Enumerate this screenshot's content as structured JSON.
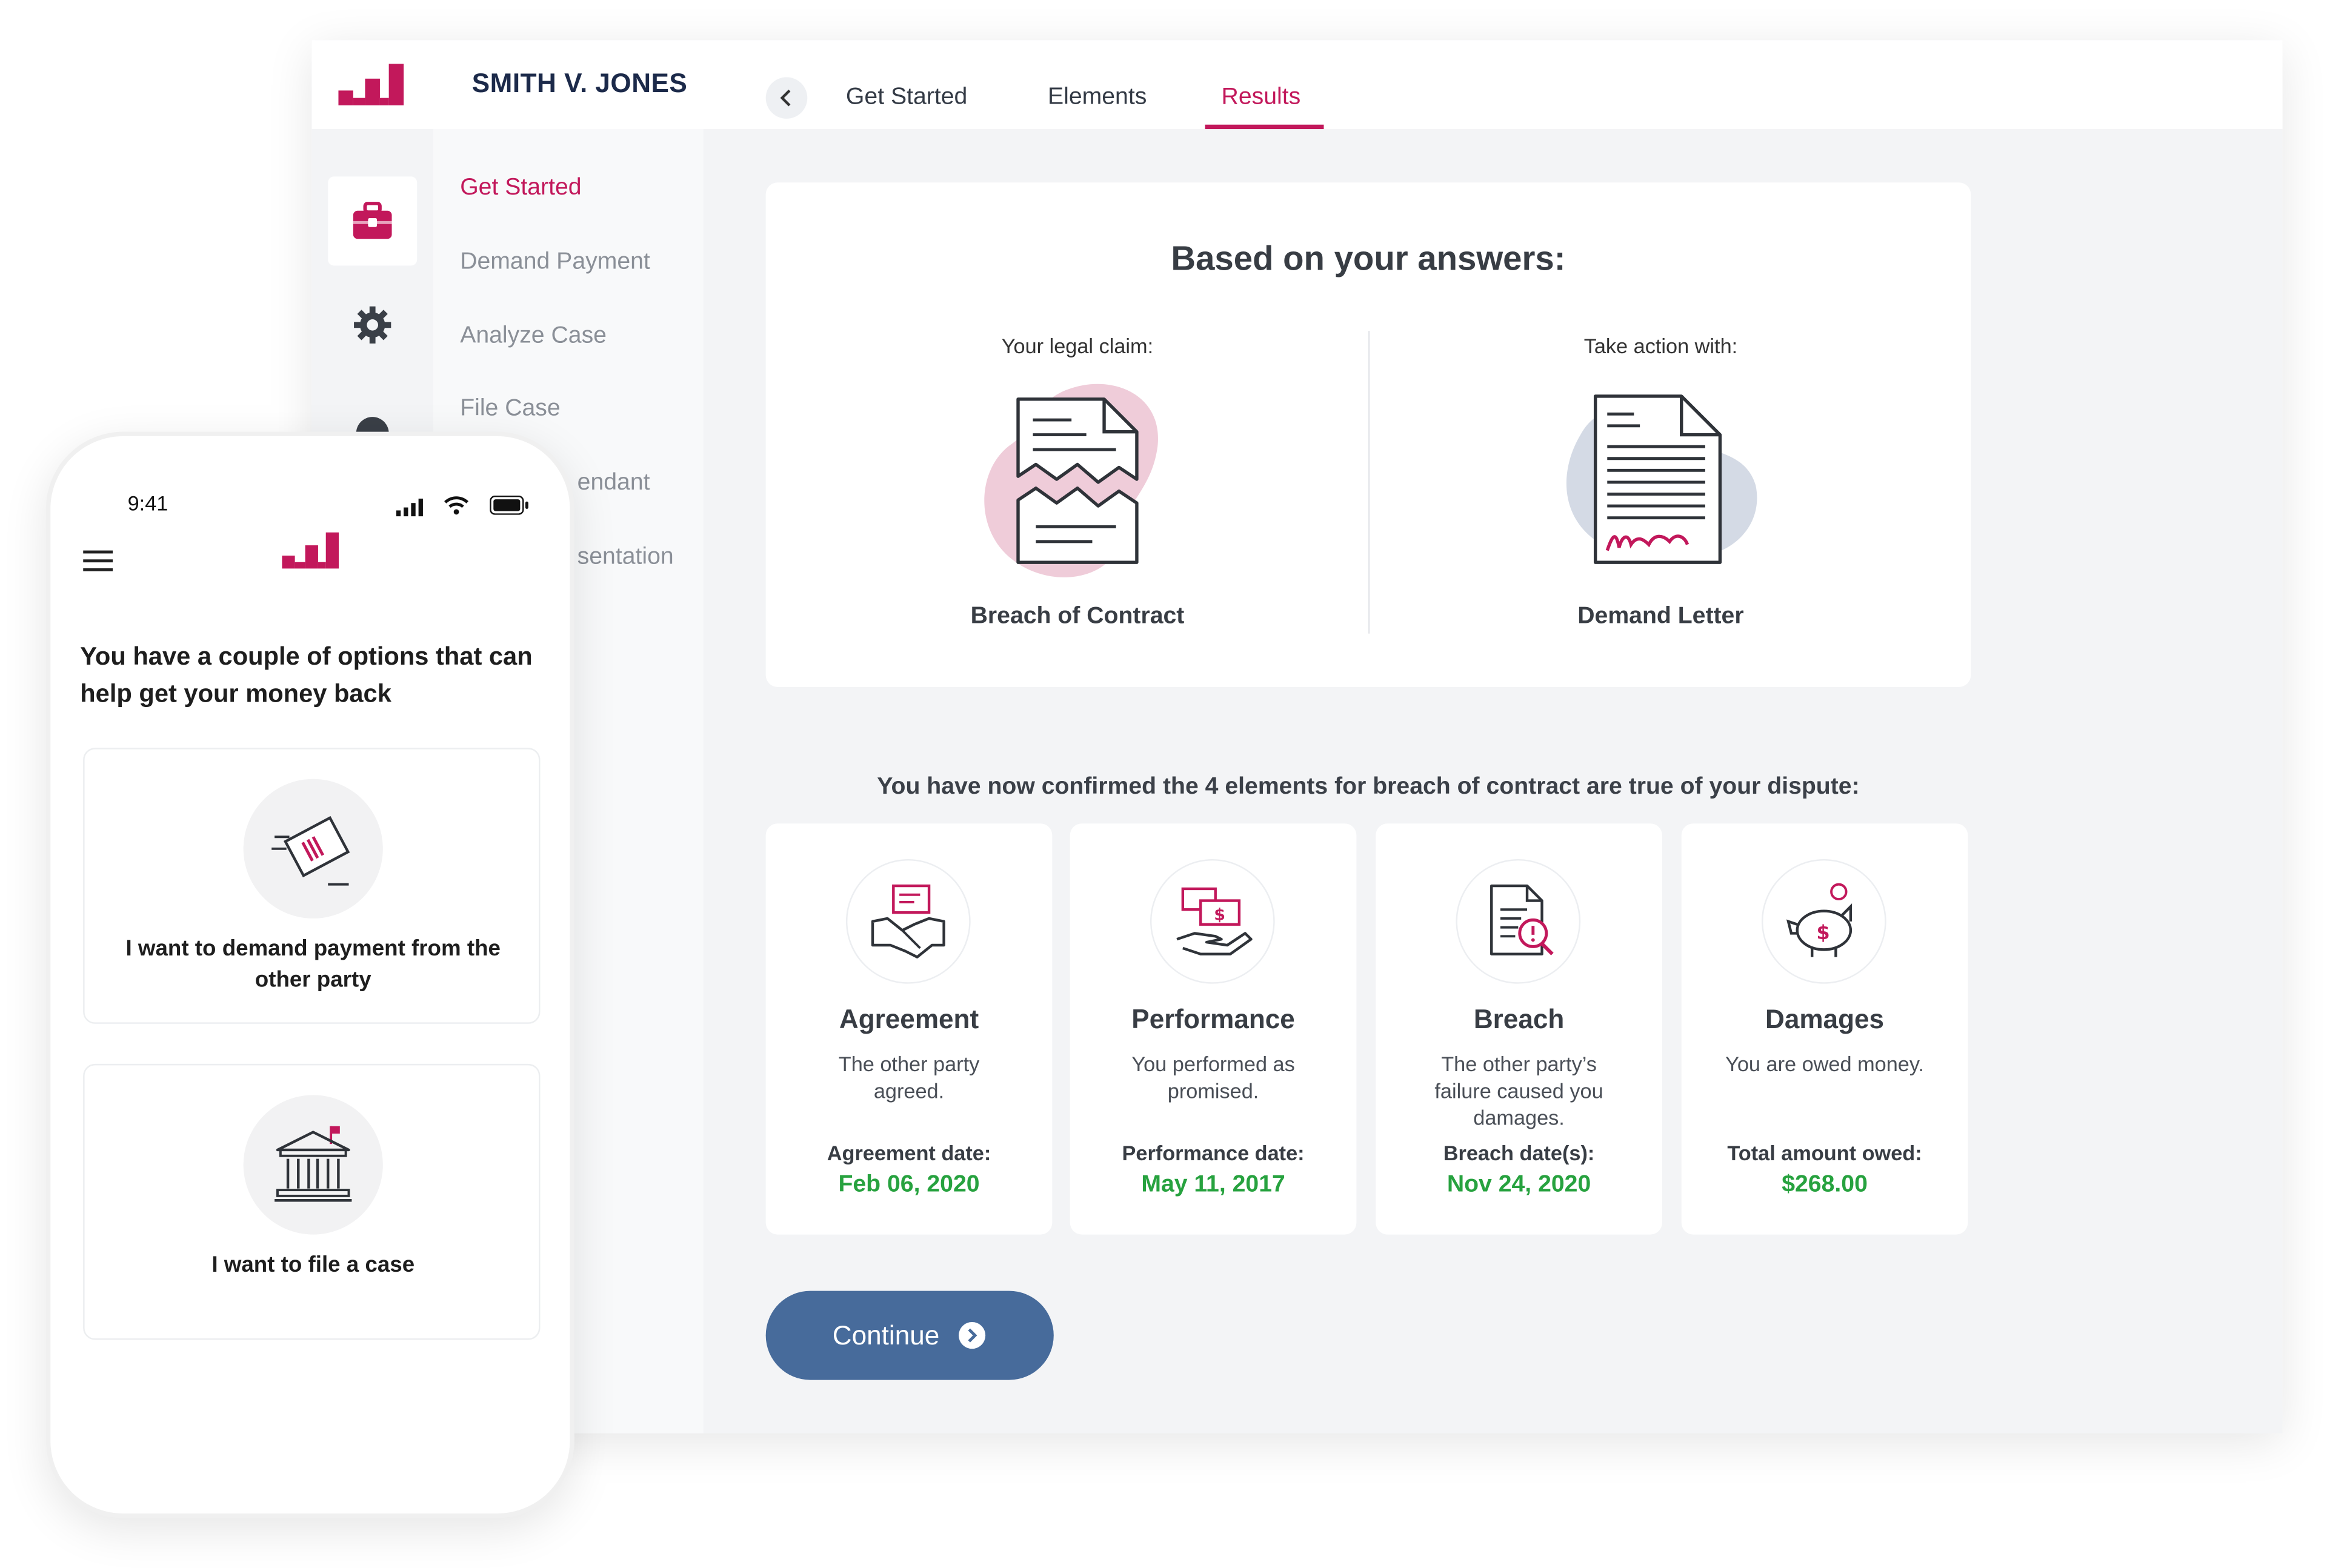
{
  "desktop": {
    "case_title": "SMITH V. JONES",
    "tabs": [
      {
        "label": "Get Started",
        "active": false
      },
      {
        "label": "Elements",
        "active": false
      },
      {
        "label": "Results",
        "active": true
      }
    ],
    "rail_icons": [
      "briefcase-icon",
      "gear-icon",
      "help-icon"
    ],
    "subnav": [
      {
        "label": "Get Started",
        "active": true
      },
      {
        "label": "Demand Payment",
        "active": false
      },
      {
        "label": "Analyze Case",
        "active": false
      },
      {
        "label": "File Case",
        "active": false
      },
      {
        "label": "endant",
        "active": false
      },
      {
        "label": "sentation",
        "active": false
      }
    ],
    "answers": {
      "title": "Based on your answers:",
      "claim_label": "Your legal claim:",
      "claim_name": "Breach of Contract",
      "action_label": "Take action with:",
      "action_name": "Demand Letter"
    },
    "confirm_text": "You have now confirmed the 4 elements for breach of contract are true of your dispute:",
    "elements": [
      {
        "title": "Agreement",
        "desc": "The other party agreed.",
        "date_label": "Agreement date:",
        "date": "Feb 06, 2020",
        "icon": "handshake-icon"
      },
      {
        "title": "Performance",
        "desc": "You performed as promised.",
        "date_label": "Performance date:",
        "date": "May 11, 2017",
        "icon": "payment-hand-icon"
      },
      {
        "title": "Breach",
        "desc": "The other party’s failure caused you damages.",
        "date_label": "Breach date(s):",
        "date": "Nov 24, 2020",
        "icon": "document-alert-icon"
      },
      {
        "title": "Damages",
        "desc": "You are owed money.",
        "date_label": "Total amount owed:",
        "date": "$268.00",
        "icon": "piggy-bank-icon"
      }
    ],
    "continue_label": "Continue"
  },
  "phone": {
    "time": "9:41",
    "heading": "You have a couple of options that can help get your money back",
    "options": [
      {
        "label": "I want to demand payment from the other party",
        "icon": "invoice-icon"
      },
      {
        "label": "I want to file a case",
        "icon": "courthouse-icon"
      }
    ]
  },
  "colors": {
    "accent": "#c2185b",
    "navy": "#1c2a4a",
    "button": "#476b9b",
    "success": "#27a23f"
  }
}
